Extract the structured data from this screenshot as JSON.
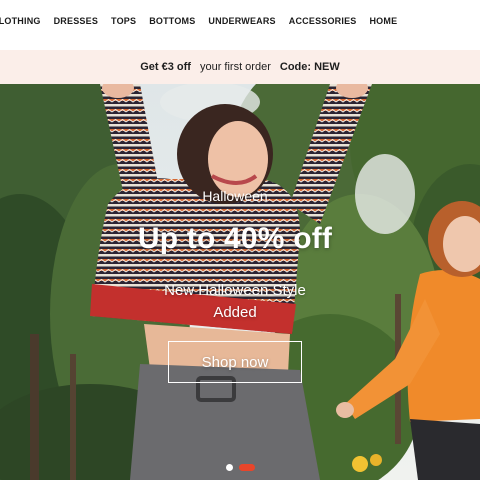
{
  "nav": {
    "items": [
      "CLOTHING",
      "DRESSES",
      "TOPS",
      "BOTTOMS",
      "UNDERWEARS",
      "ACCESSORIES",
      "HOME"
    ]
  },
  "promo": {
    "amount": "Get €3 off",
    "text": "your first order",
    "code": "Code: NEW"
  },
  "hero": {
    "subtitle": "Halloween",
    "title": "Up to 40% off",
    "description_line1": "New Halloween Style",
    "description_line2": "Added",
    "button_label": "Shop now",
    "slides_count": 2,
    "active_slide": 2,
    "indicator_active_color": "#e8452a",
    "indicator_inactive_color": "#ffffff"
  }
}
